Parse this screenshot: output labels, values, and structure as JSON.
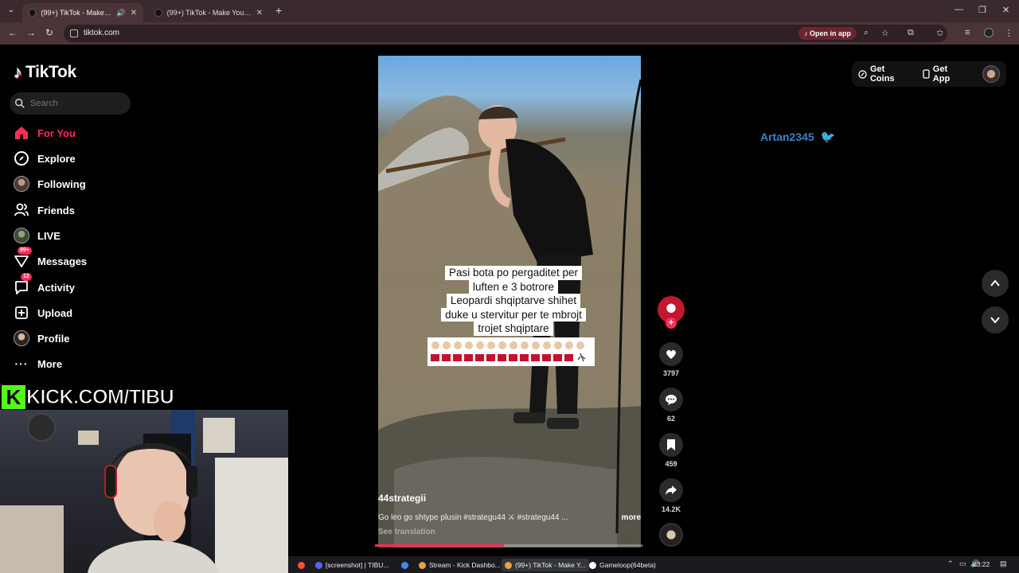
{
  "browser": {
    "tabs": [
      {
        "title": "(99+) TikTok - Make Your Day",
        "active": true
      },
      {
        "title": "(99+) TikTok - Make Your Day",
        "active": false
      }
    ],
    "url": "tiktok.com",
    "open_in_app": "Open in app"
  },
  "sidebar": {
    "logo": "TikTok",
    "search_placeholder": "Search",
    "items": [
      {
        "label": "For You",
        "icon": "home-icon",
        "active": true
      },
      {
        "label": "Explore",
        "icon": "compass-icon"
      },
      {
        "label": "Following",
        "icon": "avatar-icon"
      },
      {
        "label": "Friends",
        "icon": "friends-icon"
      },
      {
        "label": "LIVE",
        "icon": "avatar-icon"
      },
      {
        "label": "Messages",
        "icon": "messages-icon",
        "badge": "99+"
      },
      {
        "label": "Activity",
        "icon": "activity-icon",
        "badge": "12"
      },
      {
        "label": "Upload",
        "icon": "upload-icon"
      },
      {
        "label": "Profile",
        "icon": "avatar-icon"
      },
      {
        "label": "More",
        "icon": "more-icon"
      }
    ]
  },
  "overlay": {
    "kick_text": "KICK.COM/TIBU"
  },
  "video": {
    "caption_lines": [
      "Pasi bota po pergaditet per",
      "luften e 3 botrore",
      "Leopardi shqiptarve shihet",
      "duke u stervitur per te mbrojt",
      "trojet shqiptare"
    ],
    "author": "44strategii",
    "description": "Go leo go shtype plusin #strategu44 ⚔ #strategu44 ...",
    "more_label": "more",
    "see_translation": "See translation",
    "progress_fraction": 0.48
  },
  "actions": {
    "likes": "3797",
    "comments": "62",
    "saves": "459",
    "shares": "14.2K"
  },
  "topright": {
    "get_coins": "Get Coins",
    "get_app": "Get App"
  },
  "chat": {
    "username": "Artan2345"
  },
  "taskbar": {
    "apps": [
      {
        "label": "[screenshot] | TIBU...",
        "color": "#5865f2"
      },
      {
        "label": "Stream - Kick Dashbo...",
        "color": "#e8a33d",
        "active": false
      },
      {
        "label": "(99+) TikTok - Make Y...",
        "color": "#e8a33d",
        "active": true
      },
      {
        "label": "Gameloop(64beta)",
        "color": "#ffffff",
        "active": false
      }
    ],
    "clock": "23:22"
  },
  "colors": {
    "accent": "#fe2c55",
    "kick_green": "#53fc18",
    "chat_user": "#3b82c4"
  }
}
